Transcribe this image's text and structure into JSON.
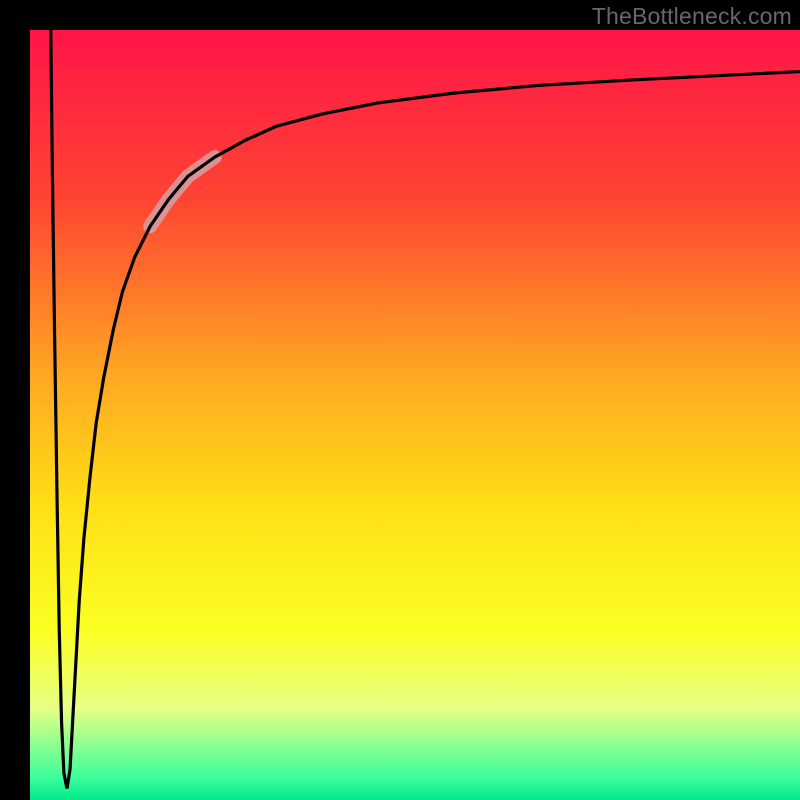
{
  "watermark": "TheBottleneck.com",
  "chart_data": {
    "type": "line",
    "title": "",
    "xlabel": "",
    "ylabel": "",
    "xlim": [
      0,
      100
    ],
    "ylim": [
      0,
      100
    ],
    "grid": false,
    "legend": false,
    "background_gradient": {
      "stops": [
        {
          "offset": 0.0,
          "color": "#ff1547"
        },
        {
          "offset": 0.22,
          "color": "#ff4433"
        },
        {
          "offset": 0.45,
          "color": "#ffa822"
        },
        {
          "offset": 0.62,
          "color": "#ffe015"
        },
        {
          "offset": 0.78,
          "color": "#fbff22"
        },
        {
          "offset": 0.88,
          "color": "#e8ff85"
        },
        {
          "offset": 0.97,
          "color": "#3dff9b"
        },
        {
          "offset": 1.0,
          "color": "#00e88b"
        }
      ]
    },
    "series": [
      {
        "name": "bottleneck-curve",
        "x": [
          2.7,
          2.9,
          3.2,
          3.5,
          3.8,
          4.1,
          4.4,
          4.8,
          5.2,
          5.8,
          6.4,
          7.0,
          7.8,
          8.6,
          9.6,
          10.8,
          12.0,
          13.6,
          15.6,
          18.0,
          20.5,
          24.0,
          28.0,
          32.0,
          38.0,
          45.0,
          55.0,
          66.0,
          78.0,
          90.0,
          100.0
        ],
        "y": [
          100.0,
          82.0,
          60.0,
          40.0,
          22.0,
          10.0,
          3.5,
          1.5,
          4.0,
          15.0,
          26.0,
          34.0,
          42.0,
          49.0,
          55.0,
          61.0,
          66.0,
          70.5,
          74.5,
          78.0,
          81.0,
          83.5,
          85.7,
          87.5,
          89.1,
          90.5,
          91.8,
          92.8,
          93.5,
          94.1,
          94.6
        ]
      }
    ],
    "highlight_segment": {
      "series": "bottleneck-curve",
      "x_range": [
        15.6,
        24.0
      ],
      "color": "#d6a0a2",
      "width": 14
    }
  },
  "axes": {
    "frame_color": "#000000"
  }
}
